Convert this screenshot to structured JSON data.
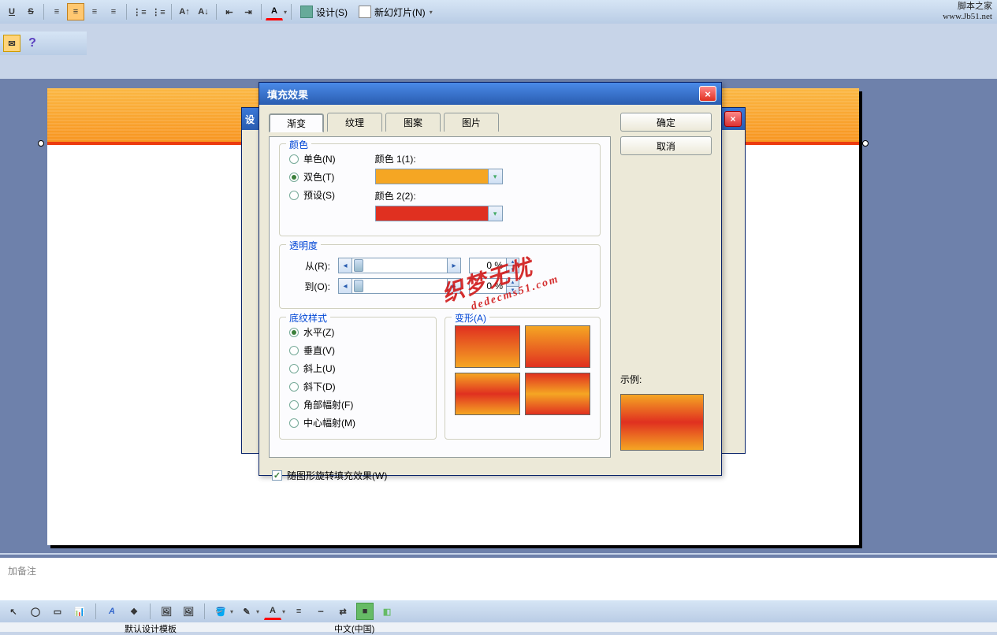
{
  "toolbar": {
    "underline": "U",
    "strike": "S",
    "design_label": "设计(S)",
    "newslide_label": "新幻灯片(N)"
  },
  "help_icon": "?",
  "watermark_site": {
    "name": "脚本之家",
    "url": "www.Jb51.net"
  },
  "notes_placeholder": "加备注",
  "status": {
    "template": "默认设计模板",
    "lang": "中文(中国)"
  },
  "dialog": {
    "title": "填充效果",
    "tabs": {
      "gradient": "渐变",
      "texture": "纹理",
      "pattern": "图案",
      "picture": "图片"
    },
    "ok": "确定",
    "cancel": "取消",
    "colors": {
      "legend": "颜色",
      "single": "单色(N)",
      "two": "双色(T)",
      "preset": "预设(S)",
      "c1_label": "颜色 1(1):",
      "c2_label": "颜色 2(2):"
    },
    "transparency": {
      "legend": "透明度",
      "from": "从(R):",
      "to": "到(O):",
      "val_from": "0 %",
      "val_to": "0 %"
    },
    "shading": {
      "legend": "底纹样式",
      "h": "水平(Z)",
      "v": "垂直(V)",
      "du": "斜上(U)",
      "dd": "斜下(D)",
      "corner": "角部幅射(F)",
      "center": "中心幅射(M)"
    },
    "variants_legend": "变形(A)",
    "sample_label": "示例:",
    "rotate_label": "随图形旋转填充效果(W)"
  },
  "wm_diag": {
    "main": "织梦无忧",
    "sub": "dedecms51.com"
  }
}
